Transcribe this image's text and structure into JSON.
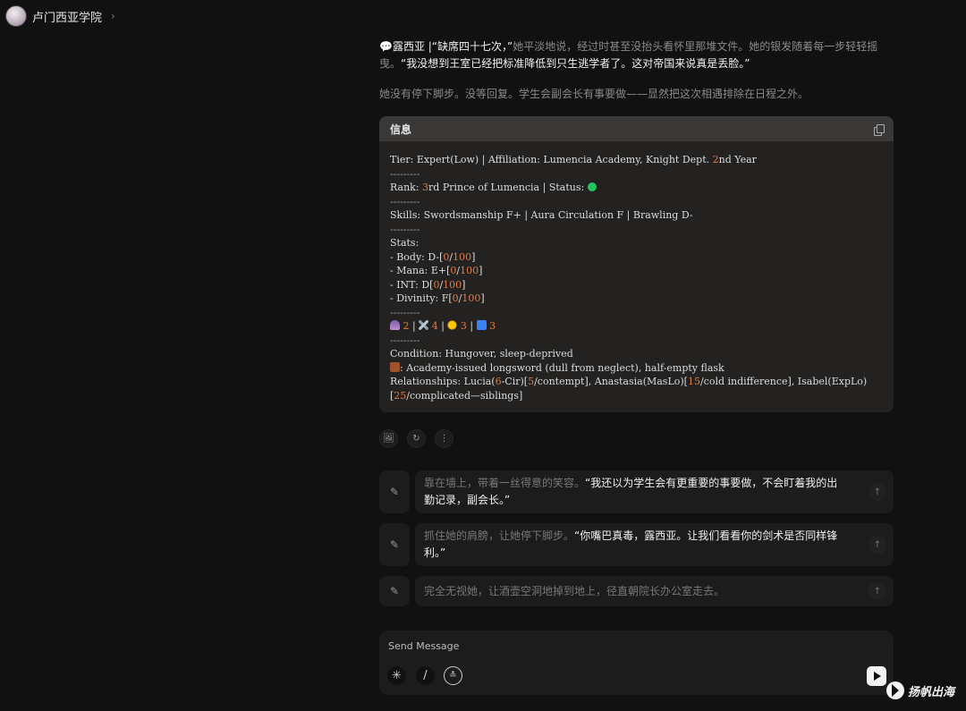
{
  "header": {
    "title": "卢门西亚学院",
    "chevron": "›"
  },
  "message1": {
    "prefix_emoji": "💬",
    "quote_a": "露西亚 |“缺席四十七次，”",
    "narration": "她平淡地说，经过时甚至没抬头看怀里那堆文件。她的银发随着每一步轻轻摇曳。",
    "quote_b": "“我没想到王室已经把标准降低到只生逃学者了。这对帝国来说真是丢脸。”"
  },
  "message2": {
    "text": "她没有停下脚步。没等回复。学生会副会长有事要做——显然把这次相遇排除在日程之外。"
  },
  "infobox": {
    "title": "信息",
    "lines": {
      "tier": "Tier: Expert(Low) | Affiliation: Lumencia Academy, Knight Dept. ",
      "tier_num": "2",
      "tier_end": "nd Year",
      "sep": "---------",
      "rank_a": "Rank: ",
      "rank_num": "3",
      "rank_b": "rd Prince of Lumencia | Status: ",
      "skills": "Skills: Swordsmanship F+ | Aura Circulation F | Brawling D-",
      "stats": "Stats:",
      "body_a": "- Body: D-[",
      "mana_a": "- Mana: E+[",
      "int_a": "- INT: D[",
      "div_a": "- Divinity: F[",
      "zero": "0",
      "slash": "/",
      "hundred": "100",
      "close": "]",
      "counts": [
        "2",
        "4",
        "3",
        "3"
      ],
      "pipe": " | ",
      "condition": "Condition: Hungover, sleep-deprived",
      "equipment": ": Academy-issued longsword (dull from neglect), half-empty flask",
      "rel_a": "Relationships: Lucia(",
      "rel_six": "6",
      "rel_b": "-Cir)[",
      "rel_five": "5",
      "rel_c": "/contempt], Anastasia(MasLo)[",
      "rel_fifteen": "15",
      "rel_d": "/cold indifference], Isabel(ExpLo)",
      "rel_e": "[",
      "rel_twentyfive": "25",
      "rel_f": "/complicated—siblings]"
    },
    "status_color": "#22c55e",
    "number_color": "#e07b45",
    "icons": [
      "mage-emoji-icon",
      "crossed-swords-emoji-icon",
      "sun-emoji-icon",
      "book-emoji-icon",
      "briefcase-emoji-icon"
    ]
  },
  "actions": {
    "image": "🖼",
    "regenerate": "↻",
    "more": "⋮"
  },
  "suggestions": [
    {
      "narration": "靠在墙上，带着一丝得意的笑容。",
      "speech": "“我还以为学生会有更重要的事要做，不会盯着我的出勤记录，副会长。”"
    },
    {
      "narration": "抓住她的肩膀，让她停下脚步。",
      "speech": "“你嘴巴真毒，露西亚。让我们看看你的剑术是否同样锋利。”"
    },
    {
      "narration": "完全无视她，让酒壶空洞地掉到地上，径直朝院长办公室走去。",
      "speech": ""
    }
  ],
  "suggestion_icons": {
    "edit": "✎",
    "send": "↑"
  },
  "composer": {
    "placeholder": "Send Message",
    "tool1": "✳",
    "tool2": "/",
    "tool3": "≛"
  },
  "watermark": {
    "text": "扬帆出海"
  }
}
